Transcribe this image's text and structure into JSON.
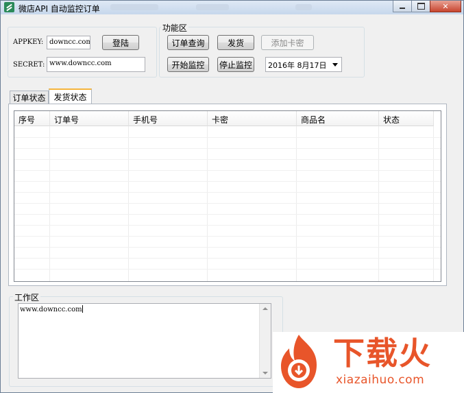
{
  "window": {
    "title": "微店API 自动监控订单",
    "controls": [
      "minimize-icon",
      "maximize-icon",
      "close-icon"
    ]
  },
  "login": {
    "appkey_label": "APPKEY:",
    "appkey_value": "downcc.com",
    "secret_label": "SECRET:",
    "secret_value": "www.downcc.com",
    "login_button": "登陆"
  },
  "functions": {
    "title": "功能区",
    "query_button": "订单查询",
    "ship_button": "发货",
    "add_card_button": "添加卡密",
    "start_button": "开始监控",
    "stop_button": "停止监控",
    "date_value": "2016年 8月17日"
  },
  "tabs": [
    {
      "label": "订单状态",
      "active": false
    },
    {
      "label": "发货状态",
      "active": true
    }
  ],
  "table": {
    "columns": [
      "序号",
      "订单号",
      "手机号",
      "卡密",
      "商品名",
      "状态"
    ],
    "rows": []
  },
  "workarea": {
    "title": "工作区",
    "content": "www.downcc.com"
  },
  "watermark": {
    "brand_text": "下载火",
    "url": "xiazaihuo.com"
  },
  "colors": {
    "tab_active_accent": "#f5b43c",
    "brand": "#e8552a",
    "close_button": "#c8452f"
  }
}
